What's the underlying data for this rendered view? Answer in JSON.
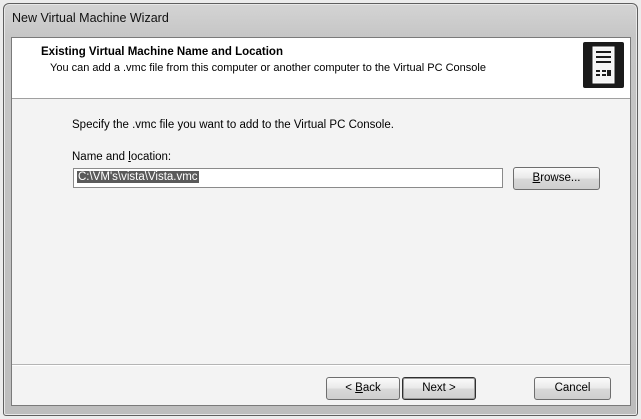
{
  "window": {
    "title": "New Virtual Machine Wizard"
  },
  "header": {
    "title": "Existing Virtual Machine Name and Location",
    "description": "You can add a .vmc file from this computer or another computer to the Virtual PC Console",
    "icon": "server-tower-icon"
  },
  "body": {
    "instruction": "Specify the .vmc file you want to add to the Virtual PC Console.",
    "name_location_label_pre": "Name and ",
    "name_location_label_access": "l",
    "name_location_label_post": "ocation:",
    "path_value": "C:\\VM's\\vista\\Vista.vmc",
    "browse_label_access": "B",
    "browse_label_rest": "rowse..."
  },
  "footer": {
    "back_label_pre": "< ",
    "back_label_access": "B",
    "back_label_rest": "ack",
    "next_label": "Next >",
    "cancel_label": "Cancel"
  }
}
